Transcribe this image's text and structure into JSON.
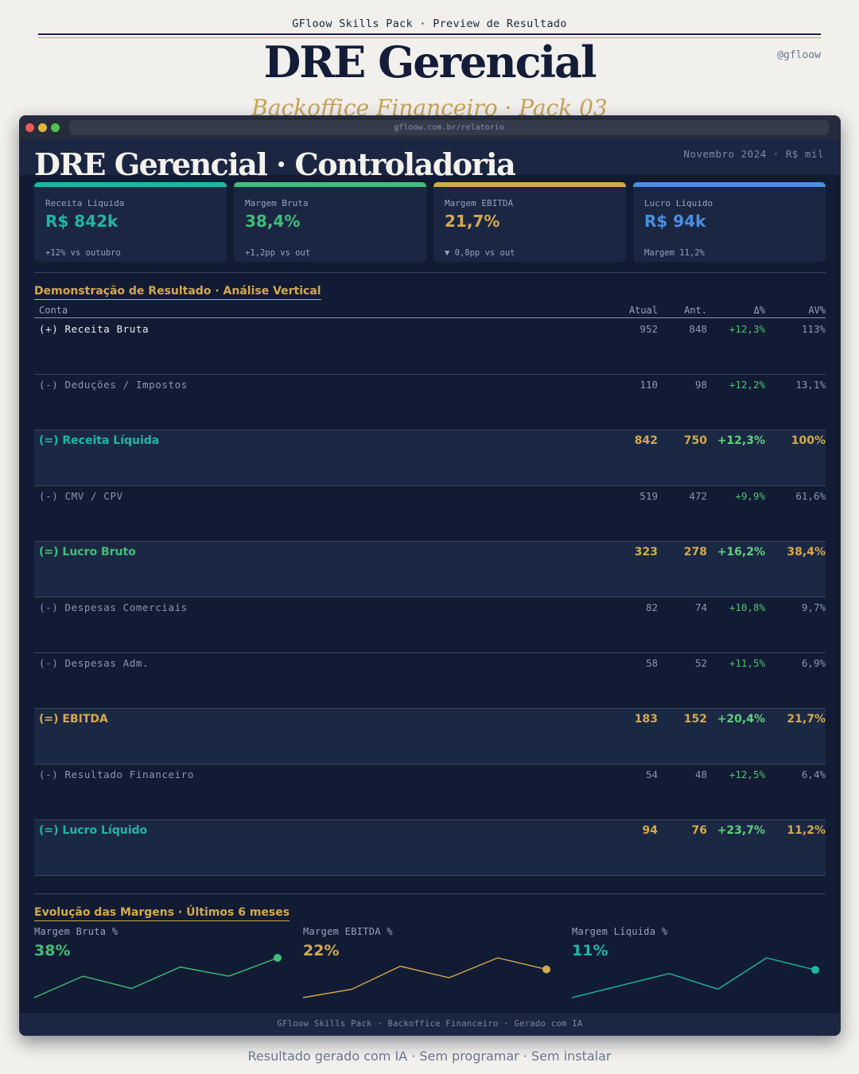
{
  "poster": {
    "top_label": "GFloow Skills Pack  ·  Preview de Resultado",
    "title": "DRE Gerencial",
    "handle": "@gfloow",
    "subtitle": "Backoffice Financeiro · Pack 03",
    "footer": "Resultado gerado com IA · Sem programar · Sem instalar"
  },
  "browser": {
    "url": "gfloow.com.br/relatorio"
  },
  "app": {
    "title": "DRE Gerencial · Controladoria",
    "meta": "Novembro 2024  ·  R$ mil",
    "footer": "GFloow Skills Pack · Backoffice Financeiro · Gerado com IA"
  },
  "kpis": [
    {
      "label": "Receita Líquida",
      "value": "R$ 842k",
      "note": "+12% vs outubro",
      "color": "#1fb6a4"
    },
    {
      "label": "Margem Bruta",
      "value": "38,4%",
      "note": "+1,2pp vs out",
      "color": "#3fbf78"
    },
    {
      "label": "Margem EBITDA",
      "value": "21,7%",
      "note": "▼ 0,8pp vs out",
      "color": "#d4a94c"
    },
    {
      "label": "Lucro Líquido",
      "value": "R$ 94k",
      "note": "Margem 11,2%",
      "color": "#4a90e2"
    }
  ],
  "table": {
    "section_title": "Demonstração de Resultado  ·  Análise Vertical",
    "headers": [
      "Conta",
      "Atual",
      "Ant.",
      "Δ%",
      "AV%"
    ],
    "rows": [
      {
        "name": "(+) Receita Bruta",
        "atual": "952",
        "ant": "848",
        "delta": "+12,3%",
        "av": "113%",
        "highlight": false
      },
      {
        "name": "(-) Deduções / Impostos",
        "atual": "110",
        "ant": "98",
        "delta": "+12,2%",
        "av": "13,1%",
        "highlight": false
      },
      {
        "name": "(=) Receita Líquida",
        "atual": "842",
        "ant": "750",
        "delta": "+12,3%",
        "av": "100%",
        "highlight": true,
        "color": "#1fb6a4"
      },
      {
        "name": "(-) CMV / CPV",
        "atual": "519",
        "ant": "472",
        "delta": "+9,9%",
        "av": "61,6%",
        "highlight": false
      },
      {
        "name": "(=) Lucro Bruto",
        "atual": "323",
        "ant": "278",
        "delta": "+16,2%",
        "av": "38,4%",
        "highlight": true,
        "color": "#3fbf78"
      },
      {
        "name": "(-) Despesas Comerciais",
        "atual": "82",
        "ant": "74",
        "delta": "+10,8%",
        "av": "9,7%",
        "highlight": false
      },
      {
        "name": "(-) Despesas Adm.",
        "atual": "58",
        "ant": "52",
        "delta": "+11,5%",
        "av": "6,9%",
        "highlight": false
      },
      {
        "name": "(=) EBITDA",
        "atual": "183",
        "ant": "152",
        "delta": "+20,4%",
        "av": "21,7%",
        "highlight": true,
        "color": "#d4a94c"
      },
      {
        "name": "(-) Resultado Financeiro",
        "atual": "54",
        "ant": "48",
        "delta": "+12,5%",
        "av": "6,4%",
        "highlight": false
      },
      {
        "name": "(=) Lucro Líquido",
        "atual": "94",
        "ant": "76",
        "delta": "+23,7%",
        "av": "11,2%",
        "highlight": true,
        "color": "#1fb6a4"
      }
    ]
  },
  "margins": {
    "section_title": "Evolução das Margens  ·  Últimos 6 meses",
    "charts": [
      {
        "label": "Margem Bruta %",
        "value": "38%",
        "color": "#3fbf78",
        "series": [
          32,
          35.5,
          33.5,
          37,
          35.5,
          38.5
        ]
      },
      {
        "label": "Margem EBITDA %",
        "value": "22%",
        "color": "#d4a94c",
        "series": [
          19.5,
          20.3,
          22.5,
          21.4,
          23.3,
          22.2
        ]
      },
      {
        "label": "Margem Líquida %",
        "value": "11%",
        "color": "#1fb6a4",
        "series": [
          8.5,
          9.5,
          10.5,
          9.2,
          11.8,
          10.8
        ]
      }
    ]
  }
}
